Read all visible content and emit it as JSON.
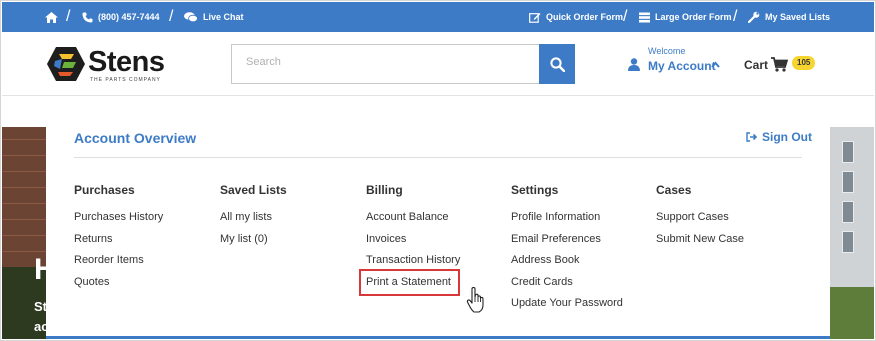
{
  "topbar": {
    "phone": "(800) 457-7444",
    "live_chat": "Live Chat",
    "quick_order": "Quick Order Form",
    "large_order": "Large Order Form",
    "saved_lists": "My Saved Lists"
  },
  "header": {
    "logo_word": "Stens",
    "logo_tagline": "THE PARTS COMPANY",
    "search_placeholder": "Search",
    "search_value": "",
    "welcome": "Welcome",
    "my_account": "My Account",
    "cart_label": "Cart",
    "cart_count": "105"
  },
  "hero": {
    "heading_fragment": "H",
    "line1_fragment": "St",
    "line2_fragment": "ac"
  },
  "account_menu": {
    "title": "Account Overview",
    "sign_out": "Sign Out",
    "columns": [
      {
        "heading": "Purchases",
        "links": [
          "Purchases History",
          "Returns",
          "Reorder Items",
          "Quotes"
        ]
      },
      {
        "heading": "Saved Lists",
        "links": [
          "All my lists",
          "My list (0)"
        ]
      },
      {
        "heading": "Billing",
        "links": [
          "Account Balance",
          "Invoices",
          "Transaction History",
          "Print a Statement"
        ]
      },
      {
        "heading": "Settings",
        "links": [
          "Profile Information",
          "Email Preferences",
          "Address Book",
          "Credit Cards",
          "Update Your Password"
        ]
      },
      {
        "heading": "Cases",
        "links": [
          "Support Cases",
          "Submit New Case"
        ]
      }
    ],
    "highlighted_link": "Print a Statement"
  },
  "colors": {
    "brand_blue": "#3d7bc6",
    "highlight_red": "#d9383a",
    "badge_yellow": "#f6d530"
  },
  "icons": [
    "home-icon",
    "phone-icon",
    "chat-icon",
    "edit-icon",
    "list-icon",
    "wrench-icon",
    "search-icon",
    "user-icon",
    "chevron-up-icon",
    "cart-icon",
    "sign-out-icon",
    "hand-cursor-icon"
  ]
}
